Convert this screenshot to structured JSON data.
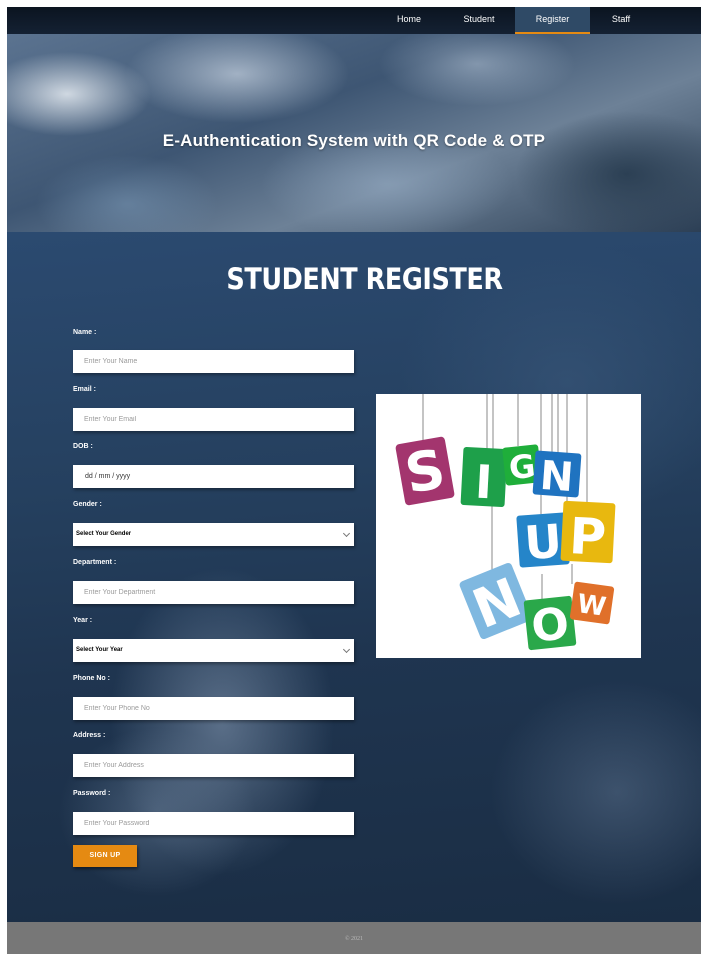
{
  "nav": {
    "items": [
      {
        "label": "Home"
      },
      {
        "label": "Student"
      },
      {
        "label": "Register"
      },
      {
        "label": "Staff"
      }
    ],
    "active": "Register",
    "accent_color": "#e58a12"
  },
  "hero": {
    "title": "E-Authentication System with QR Code & OTP"
  },
  "form": {
    "heading": "STUDENT REGISTER",
    "fields": {
      "name": {
        "label": "Name :",
        "placeholder": "Enter Your Name"
      },
      "email": {
        "label": "Email :",
        "placeholder": "Enter Your Email"
      },
      "dob": {
        "label": "DOB :",
        "value": "dd / mm / yyyy"
      },
      "gender": {
        "label": "Gender :",
        "selected": "Select Your Gender"
      },
      "department": {
        "label": "Department :",
        "placeholder": "Enter Your Department"
      },
      "year": {
        "label": "Year :",
        "selected": "Select Your Year"
      },
      "phone": {
        "label": "Phone No :",
        "placeholder": "Enter Your Phone No"
      },
      "address": {
        "label": "Address :",
        "placeholder": "Enter Your Address"
      },
      "password": {
        "label": "Password :",
        "placeholder": "Enter Your Password"
      }
    },
    "submit_label": "SIGN UP",
    "submit_color": "#e58a12"
  },
  "illustration": {
    "letters": [
      {
        "char": "S",
        "color": "#a3356e"
      },
      {
        "char": "I",
        "color": "#1ea04a"
      },
      {
        "char": "G",
        "color": "#1fae3a"
      },
      {
        "char": "N",
        "color": "#1f73c0"
      },
      {
        "char": "U",
        "color": "#2585c9"
      },
      {
        "char": "P",
        "color": "#e8b80f"
      },
      {
        "char": "N",
        "color": "#7fb8e0"
      },
      {
        "char": "O",
        "color": "#2aa84a"
      },
      {
        "char": "W",
        "color": "#e0702a"
      }
    ]
  },
  "footer": {
    "copyright": "© 2021"
  }
}
